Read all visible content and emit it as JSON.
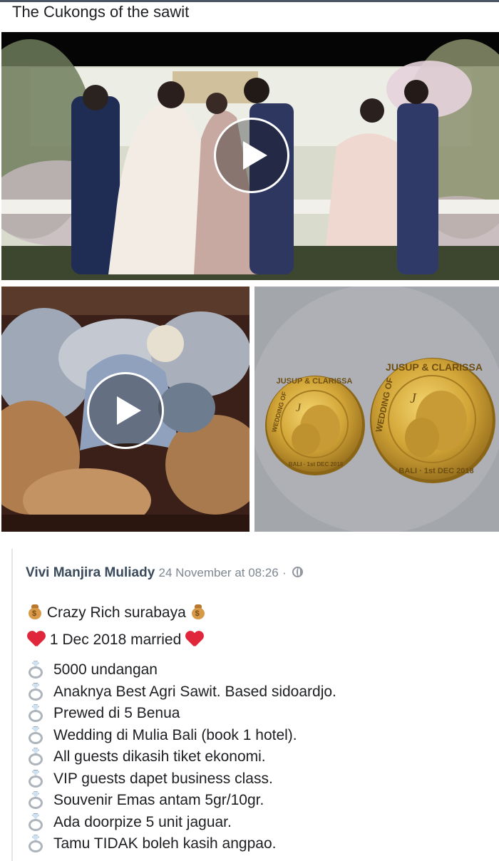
{
  "post_title": "The Cukongs of the sawit",
  "media": {
    "coin_small": {
      "top_text": "JUSUP & CLARISSA",
      "left_text": "WEDDING OF",
      "bottom_text": "BALI · 1st DEC 2018",
      "monogram": "J"
    },
    "coin_large": {
      "top_text": "JUSUP & CLARISSA",
      "left_text": "WEDDING OF",
      "bottom_text": "BALI · 1st DEC 2018",
      "monogram": "J"
    }
  },
  "post": {
    "author": "Vivi Manjira Muliady",
    "timestamp": "24 November at 08:26",
    "separator": "·",
    "line1": "Crazy Rich surabaya",
    "line2": "1 Dec 2018 married",
    "items": [
      "5000 undangan",
      "Anaknya Best Agri Sawit. Based sidoardjo.",
      "Prewed di 5 Benua",
      "Wedding di Mulia Bali (book 1 hotel).",
      "All guests dikasih tiket ekonomi.",
      "VIP guests dapet business class.",
      "Souvenir Emas antam 5gr/10gr.",
      "Ada doorpize 5 unit jaguar.",
      "Tamu TIDAK boleh kasih angpao."
    ]
  },
  "icons": {
    "line1_emoji": "money-bag-icon",
    "line2_emoji": "heart-icon",
    "list_emoji": "ring-icon",
    "privacy": "globe-icon",
    "video": "play-icon"
  },
  "colors": {
    "heart": "#e0263a",
    "gold": "#c9a23a",
    "author": "#3b4a5a",
    "meta": "#7f8790"
  }
}
